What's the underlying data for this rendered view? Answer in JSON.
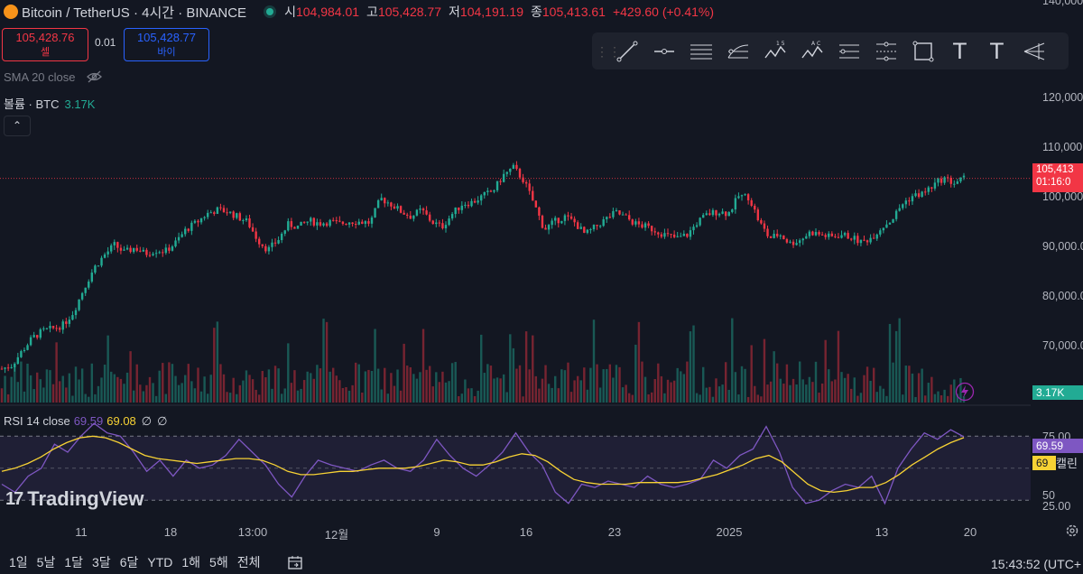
{
  "header": {
    "title": "Bitcoin / TetherUS · 4시간 · BINANCE",
    "open_label": "시",
    "open": "104,984.01",
    "high_label": "고",
    "high": "105,428.77",
    "low_label": "저",
    "low": "104,191.19",
    "close_label": "종",
    "close": "105,413.61",
    "change": "+429.60 (+0.41%)"
  },
  "trade": {
    "sell_price": "105,428.76",
    "sell_label": "셀",
    "spread": "0.01",
    "buy_price": "105,428.77",
    "buy_label": "바이"
  },
  "indicators": {
    "sma": "SMA 20 close",
    "volume_label": "볼륨 · BTC",
    "volume_value": "3.17K",
    "rsi_label": "RSI 14 close",
    "rsi_value": "69.59",
    "rsi_ma_value": "69.08",
    "rsi_null1": "∅",
    "rsi_null2": "∅"
  },
  "price_axis": {
    "ticks": [
      "140,000",
      "120,000",
      "110,000",
      "100,000",
      "90,000.0",
      "80,000.0",
      "70,000.0"
    ],
    "current_price": "105,413",
    "countdown": "01:16:0",
    "volume_tag": "3.17K",
    "rsi_tag": "69.59",
    "rsi_ma_tag": "69",
    "rsi_ticks": [
      "75.00",
      "50",
      "25.00"
    ],
    "overflow_label": "캘린"
  },
  "time_axis": {
    "ticks": [
      "11",
      "18",
      "13:00",
      "12월",
      "9",
      "16",
      "23",
      "2025",
      "13",
      "20"
    ]
  },
  "ranges": [
    "1일",
    "5날",
    "1달",
    "3달",
    "6달",
    "YTD",
    "1해",
    "5해",
    "전체"
  ],
  "clock": "15:43:52 (UTC+",
  "brand": "TradingView",
  "toolbar_text_tools": [
    "T",
    "T"
  ],
  "colors": {
    "up": "#22ab94",
    "down": "#f23645",
    "rsi": "#7e57c2",
    "rsi_ma": "#f7d234",
    "background": "#131722"
  },
  "chart_data": {
    "type": "candlestick",
    "symbol": "Bitcoin / TetherUS",
    "interval": "4시간",
    "ylim": [
      63000,
      140000
    ],
    "closes": [
      68500,
      69200,
      72000,
      74500,
      75800,
      76300,
      77000,
      79500,
      84000,
      88000,
      90500,
      92500,
      91000,
      92000,
      90800,
      91500,
      91300,
      93000,
      95500,
      96800,
      98500,
      99300,
      99000,
      98000,
      97000,
      93500,
      91500,
      93500,
      96500,
      96000,
      97200,
      96700,
      97000,
      96600,
      97100,
      97000,
      96800,
      101500,
      100500,
      99000,
      98000,
      99300,
      97000,
      96000,
      98500,
      100500,
      100800,
      102000,
      103000,
      106000,
      107500,
      105000,
      100500,
      95500,
      97000,
      98000,
      96800,
      94500,
      96000,
      97500,
      98800,
      97800,
      96500,
      96000,
      95200,
      94300,
      93800,
      94500,
      97000,
      98500,
      99000,
      98600,
      102000,
      101800,
      97000,
      93800,
      94600,
      92800,
      93500,
      95000,
      94500,
      94000,
      94500,
      94000,
      93000,
      94000,
      96000,
      97500,
      100500,
      102000,
      102500,
      104000,
      105500,
      104500,
      105413
    ],
    "rsi": {
      "length": 14,
      "ylim": [
        20,
        82
      ],
      "rsi_values": [
        40,
        35,
        45,
        50,
        65,
        60,
        70,
        78,
        72,
        70,
        60,
        48,
        55,
        45,
        55,
        50,
        52,
        58,
        68,
        60,
        52,
        40,
        32,
        45,
        55,
        52,
        50,
        48,
        52,
        55,
        50,
        48,
        55,
        68,
        58,
        50,
        45,
        52,
        60,
        72,
        60,
        52,
        35,
        28,
        40,
        38,
        42,
        40,
        38,
        45,
        40,
        38,
        40,
        43,
        55,
        50,
        58,
        62,
        76,
        60,
        38,
        28,
        30,
        36,
        40,
        38,
        45,
        28,
        50,
        62,
        72,
        68,
        74,
        69.59
      ],
      "ma_values": [
        48,
        50,
        53,
        57,
        62,
        66,
        69,
        70,
        69,
        66,
        62,
        58,
        56,
        55,
        54,
        53,
        54,
        55,
        56,
        56,
        55,
        52,
        48,
        46,
        46,
        47,
        48,
        48,
        49,
        50,
        50,
        50,
        51,
        53,
        55,
        54,
        52,
        52,
        54,
        57,
        59,
        58,
        54,
        48,
        43,
        41,
        40,
        40,
        40,
        41,
        41,
        41,
        41,
        42,
        44,
        46,
        49,
        52,
        56,
        58,
        54,
        47,
        40,
        36,
        35,
        36,
        38,
        38,
        41,
        46,
        52,
        57,
        62,
        66,
        69.08
      ]
    }
  }
}
